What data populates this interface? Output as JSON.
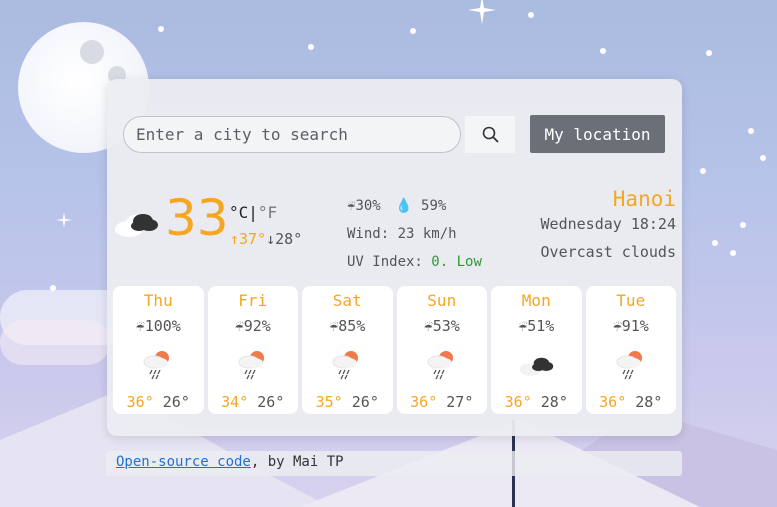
{
  "search": {
    "placeholder": "Enter a city to search",
    "icon": "search-icon"
  },
  "location_button": "My location",
  "current": {
    "icon": "cloudy-icon",
    "temperature": "33",
    "unit_c": "°C",
    "unit_sep": "|",
    "unit_f": "°F",
    "high": "↑37°",
    "low": "↓28°",
    "rain_chance": "30%",
    "humidity": "59%",
    "wind": "Wind: 23 km/h",
    "uv_label": "UV Index: ",
    "uv_value": "0. Low",
    "city": "Hanoi",
    "datetime": "Wednesday 18:24",
    "description": "Overcast clouds"
  },
  "forecast": [
    {
      "day": "Thu",
      "rain": "100%",
      "icon": "rain-sun-icon",
      "high": "36°",
      "low": "26°"
    },
    {
      "day": "Fri",
      "rain": "92%",
      "icon": "rain-sun-icon",
      "high": "34°",
      "low": "26°"
    },
    {
      "day": "Sat",
      "rain": "85%",
      "icon": "rain-sun-icon",
      "high": "35°",
      "low": "26°"
    },
    {
      "day": "Sun",
      "rain": "53%",
      "icon": "rain-sun-icon",
      "high": "36°",
      "low": "27°"
    },
    {
      "day": "Mon",
      "rain": "51%",
      "icon": "cloudy-icon",
      "high": "36°",
      "low": "28°"
    },
    {
      "day": "Tue",
      "rain": "91%",
      "icon": "rain-sun-icon",
      "high": "36°",
      "low": "28°"
    }
  ],
  "footer": {
    "link": "Open-source code",
    "text": ", by Mai TP"
  },
  "colors": {
    "accent": "#f6a623",
    "uv_low": "#2e9a2e",
    "button": "#6b7078",
    "link": "#1f6fd6"
  }
}
